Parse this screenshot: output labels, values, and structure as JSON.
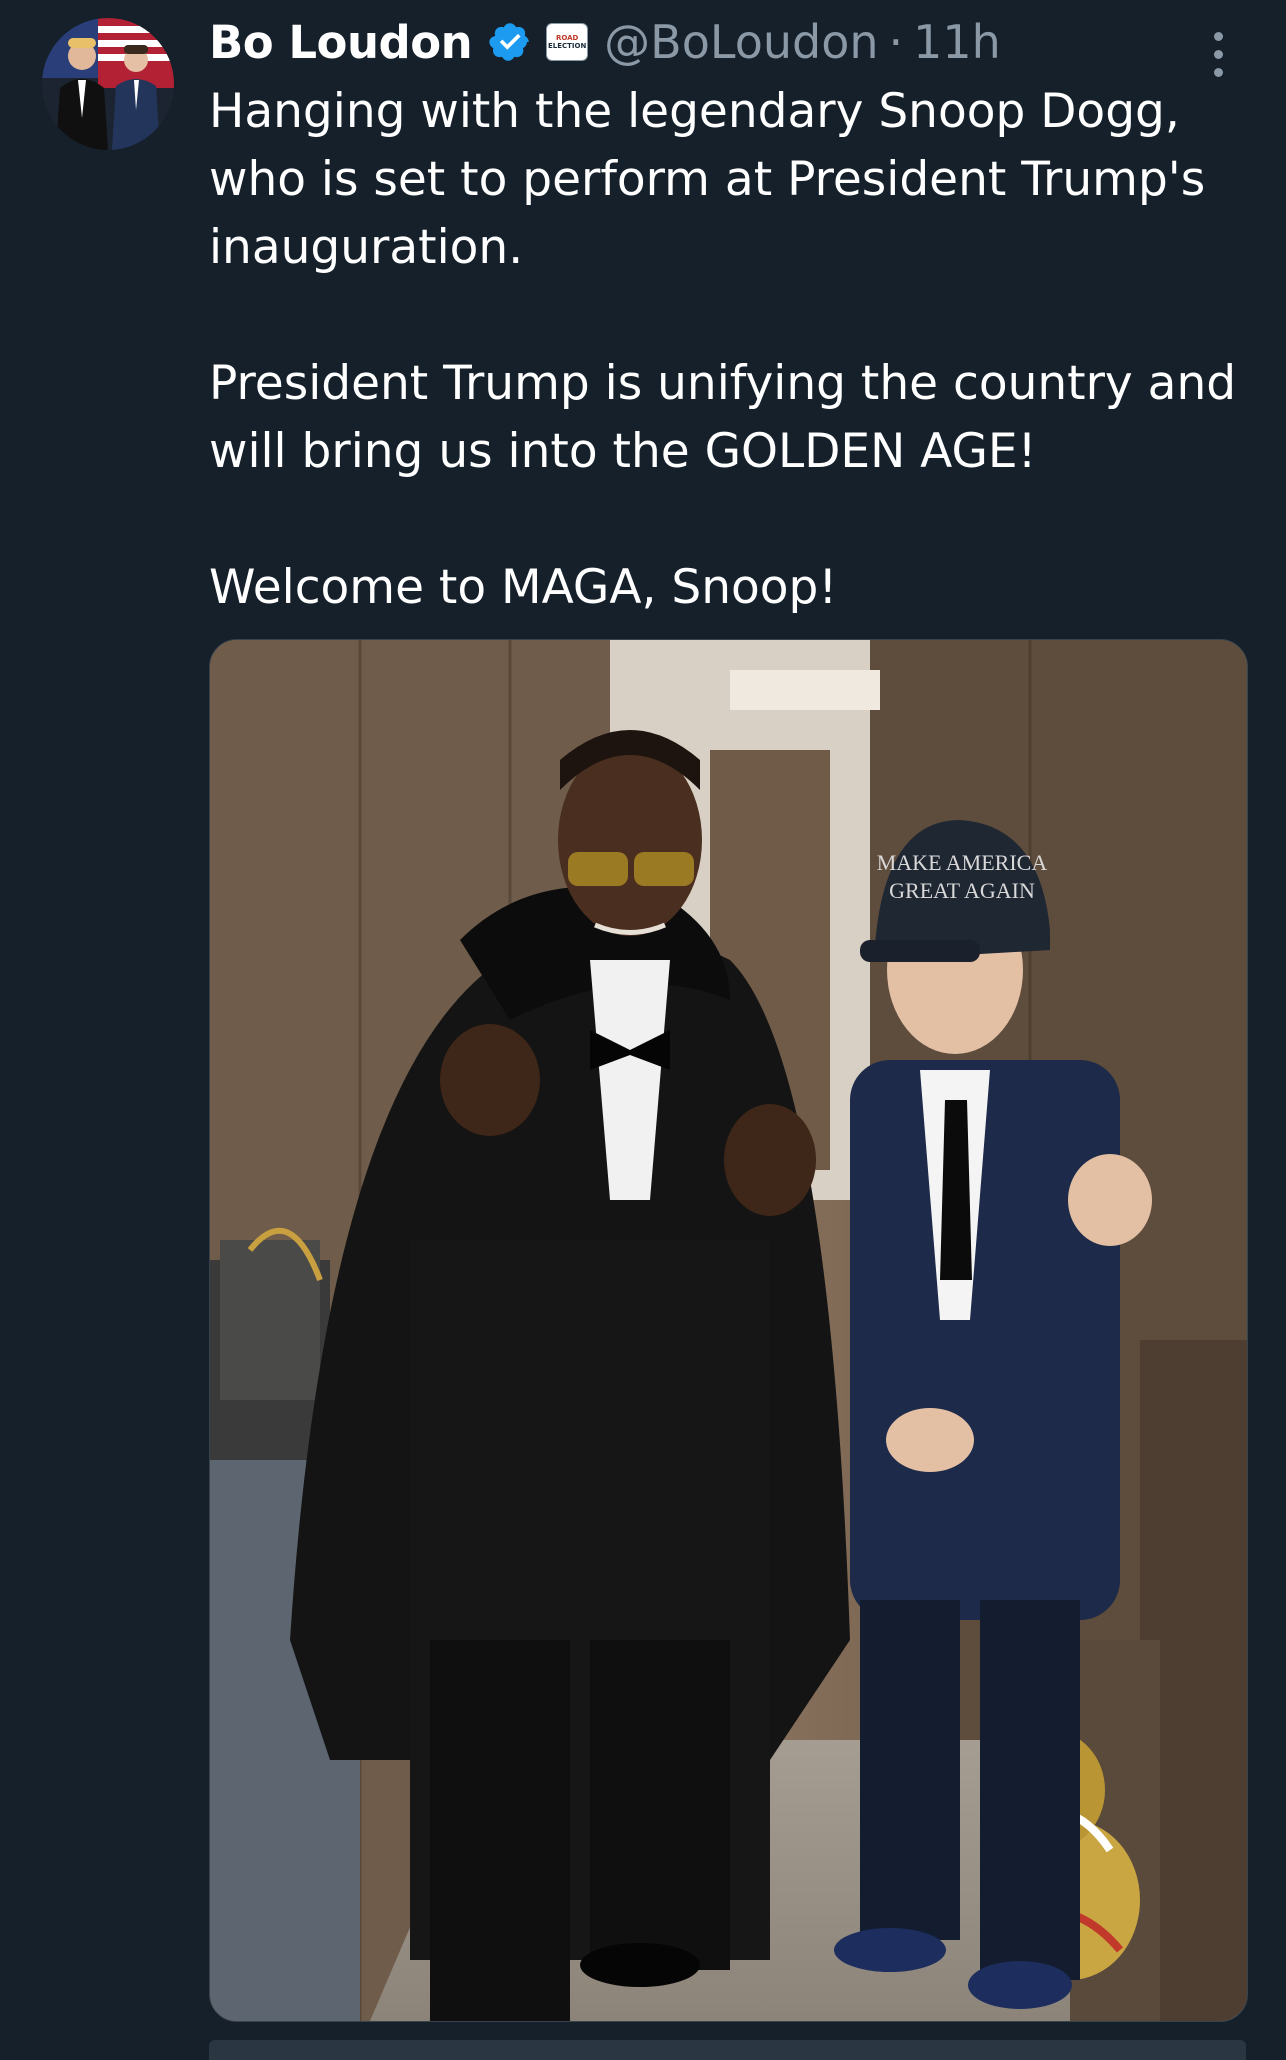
{
  "author": {
    "name": "Bo Loudon",
    "handle": "@BoLoudon",
    "time": "11h",
    "separator": "·",
    "verified_icon": "verified-badge-icon",
    "affiliation_badge": [
      "ROAD",
      "ELECTION"
    ]
  },
  "tweet": {
    "paragraphs": [
      "Hanging with the legendary Snoop Dogg, who is set to perform at President Trump's inauguration.",
      "President Trump is unifying the country and will bring us into the GOLDEN AGE!",
      "Welcome to MAGA, Snoop!"
    ]
  },
  "media": {
    "hat_text": [
      "MAKE AMERICA",
      "GREAT AGAIN"
    ]
  },
  "colors": {
    "background": "#15202b",
    "text": "#ffffff",
    "muted": "#8b98a5",
    "verified": "#1d9bf0"
  }
}
